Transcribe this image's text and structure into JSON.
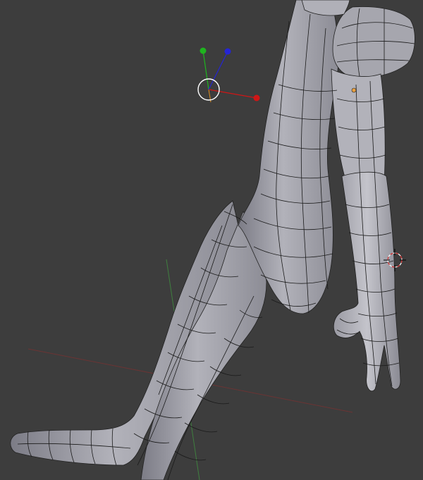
{
  "viewport": {
    "background_color": "#3d3d3d",
    "mesh_color": "#a9a9b1",
    "wire_color": "#111111"
  },
  "manipulator": {
    "x_axis_color": "#d01616",
    "y_axis_color": "#1fb41f",
    "z_axis_color": "#2525d6",
    "view_axis_color": "#e09020",
    "ring_color": "#ffffff"
  },
  "object_origin": {
    "color": "#e8a040"
  },
  "cursor_3d": {
    "icon": "3d-cursor-icon",
    "ring_color": "#cc2222"
  },
  "grid": {
    "x_axis_color": "#6b3434",
    "y_axis_color": "#3f7f3f"
  }
}
